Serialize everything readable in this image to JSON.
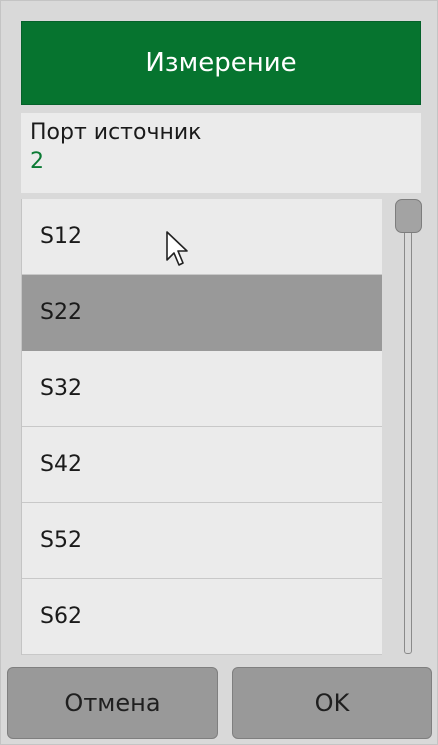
{
  "dialog": {
    "title": "Измерение",
    "info": {
      "label": "Порт источник",
      "value": "2"
    },
    "list": {
      "items": [
        {
          "label": "S12",
          "selected": false
        },
        {
          "label": "S22",
          "selected": true
        },
        {
          "label": "S32",
          "selected": false
        },
        {
          "label": "S42",
          "selected": false
        },
        {
          "label": "S52",
          "selected": false
        },
        {
          "label": "S62",
          "selected": false
        }
      ],
      "scroll_position": 0
    },
    "buttons": {
      "cancel_label": "Отмена",
      "ok_label": "OK"
    },
    "colors": {
      "title_bar": "#06742f",
      "value_text": "#0b7a34",
      "selected_item": "#999999"
    }
  }
}
